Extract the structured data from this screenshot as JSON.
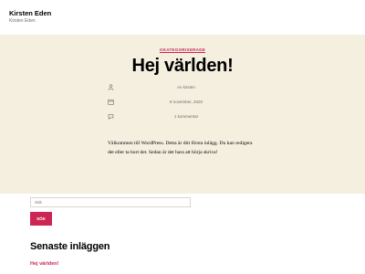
{
  "site": {
    "title": "Kirsten Eden",
    "description": "Kirsten Eden"
  },
  "post": {
    "category": "OKATEGORISERADE",
    "title": "Hej världen!",
    "meta": {
      "author": "Av kirsten",
      "author_icon": "person-icon",
      "date": "8 november, 2020",
      "date_icon": "calendar-icon",
      "comments": "1 kommentar",
      "comments_icon": "speech-bubble-icon"
    },
    "body": "Välkommen till WordPress. Detta är ditt första inlägg. Du kan redigera det eller ta bort det. Sedan är det bara att börja skriva!"
  },
  "search": {
    "placeholder": "Sök",
    "button_label": "SÖK"
  },
  "recent_posts": {
    "heading": "Senaste inläggen",
    "items": [
      {
        "title": "Hej världen!"
      }
    ]
  },
  "colors": {
    "accent": "#cd2653",
    "hero_background": "#f5efe0",
    "muted_text": "#6d6d6d"
  }
}
